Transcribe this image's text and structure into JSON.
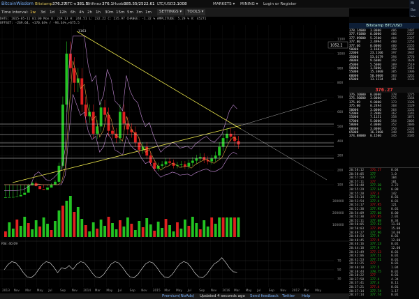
{
  "topbar": {
    "logo": "BitcoinWisdom",
    "markets": [
      {
        "name": "Bitstamp",
        "price": "376.27",
        "active": true
      },
      {
        "name": "BTC-e",
        "price": "381.5"
      },
      {
        "name": "Bitfinex",
        "price": "376.1"
      },
      {
        "name": "Huobi",
        "price": "385.55/2522.61"
      },
      {
        "name": "LTC/USD",
        "price": "3.1008"
      }
    ],
    "markets_menu": "MARKETS",
    "mining_menu": "MINING",
    "login": "Login or Register",
    "right_partial": [
      "Bi",
      "Re",
      "Ha"
    ]
  },
  "toolbar": {
    "label": "Time Interval:",
    "intervals": [
      "1w",
      "3d",
      "1d",
      "12h",
      "6h",
      "4h",
      "2h",
      "1h",
      "30m",
      "15m",
      "5m",
      "3m",
      "1m"
    ],
    "selected": "1w",
    "settings": "SETTINGS",
    "tools": "TOOLS"
  },
  "info": {
    "line1": "DATE: 2015-05-11 01:00 Mon   O: 239.13  H: 244.51   L: 232.22   C: 235.97  CHANGE: -1.32 %  AMPLITUDE: 5.29 %  V: 45271",
    "line2": "OFFSET: -269.64, +170.64% / -94.34%,+675.5"
  },
  "chart_data": {
    "type": "candlestick",
    "x_axis_labels": [
      "2013",
      "Nov",
      "Mar",
      "May",
      "Jul",
      "Sep",
      "Nov",
      "2014",
      "Mar",
      "May",
      "Jul",
      "Sep",
      "Nov",
      "2015",
      "Mar",
      "May",
      "Jul",
      "Sep",
      "Nov",
      "2016",
      "Mar",
      "May",
      "Jul",
      "Sep",
      "Nov",
      "2017",
      "Mar",
      "May",
      "Nov"
    ],
    "y_axis_labels": [
      "1100",
      "1000",
      "900",
      "800",
      "700",
      "600",
      "500",
      "400",
      "300",
      "200",
      "100"
    ],
    "price_box": "1052.2",
    "peak_label": "1163",
    "volume_axis_labels": [
      "300000",
      "200000",
      "100000"
    ],
    "rsi_label": "RSI: 40.09",
    "rsi_axis_labels": [
      "70",
      "50",
      "30"
    ],
    "close_series": [
      14,
      15,
      16,
      20,
      30,
      45,
      95,
      110,
      90,
      70,
      65,
      80,
      100,
      120,
      230,
      650,
      1000,
      900,
      800,
      830,
      650,
      570,
      600,
      450,
      500,
      630,
      580,
      470,
      450,
      420,
      600,
      520,
      480,
      460,
      390,
      340,
      360,
      300,
      250,
      210,
      230,
      240,
      260,
      250,
      230,
      235,
      240,
      225,
      250,
      265,
      280,
      290,
      270,
      260,
      280,
      300,
      360,
      420,
      450,
      430,
      400,
      376
    ]
  },
  "orderbook": {
    "title": "Bitstamp BTC/USD",
    "last_price": "376.27",
    "asks": [
      [
        "378.14000",
        "3.0000",
        "406",
        "2487"
      ],
      [
        "377.91000",
        "0.0000",
        "406",
        "2337"
      ],
      [
        "377.89000",
        "5.2500",
        "404",
        "2327"
      ],
      [
        "377.80",
        "2.4994",
        "400",
        "2253"
      ],
      [
        "377.66",
        "0.0000",
        "400",
        "2155"
      ],
      [
        "50000",
        "3.1682",
        "398",
        "1988"
      ],
      [
        "22000",
        "23.1106",
        "397",
        "1947"
      ],
      [
        "35000",
        "53.6179",
        "394",
        "1776"
      ],
      [
        "40000",
        "9.6000",
        "392",
        "1628"
      ],
      [
        "45000",
        "5.5000",
        "389",
        "1519"
      ],
      [
        "50000",
        "1.5000",
        "387",
        "1413"
      ],
      [
        "55000",
        "15.3000",
        "385",
        "1306"
      ],
      [
        "60000",
        "50.0000",
        "383",
        "1261"
      ],
      [
        "65000",
        "13.1234",
        "381",
        "1133"
      ]
    ],
    "bids": [
      [
        "376.10000",
        "0.0000",
        "378",
        "1275"
      ],
      [
        "375.50000",
        "3.0000",
        "375",
        "1164"
      ],
      [
        "375.09",
        "9.0000",
        "373",
        "1126"
      ],
      [
        "375.00",
        "0.2494",
        "368",
        "1129"
      ],
      [
        "50000",
        "3.0000",
        "364",
        "1131"
      ],
      [
        "52000",
        "2.2000",
        "362",
        "1141"
      ],
      [
        "55000",
        "7.1151",
        "358",
        "1871"
      ],
      [
        "57000",
        "5.0000",
        "354",
        "2005"
      ],
      [
        "58000",
        "4.0000",
        "352",
        "2086"
      ],
      [
        "60000",
        "3.0000",
        "350",
        "2234"
      ],
      [
        "65000",
        "16.2000",
        "348",
        "2483"
      ],
      [
        "374.88000",
        "0.1500",
        "345",
        "3185"
      ]
    ],
    "trades": [
      [
        "20:58:12",
        "376.27",
        "0.04"
      ],
      [
        "20:58:05",
        "377",
        "1.0"
      ],
      [
        "20:57:59",
        "377",
        "104"
      ],
      [
        "20:57:11",
        "377",
        "101"
      ],
      [
        "20:56:48",
        "377.38",
        "3.72"
      ],
      [
        "20:55:29",
        "377.64",
        "0.08"
      ],
      [
        "20:55:28",
        "377.4",
        "142"
      ],
      [
        "20:55:14",
        "377.4",
        "0.01"
      ],
      [
        "20:53:54",
        "377.4",
        "0.01"
      ],
      [
        "20:53:17",
        "377.95",
        "121"
      ],
      [
        "20:52:30",
        "377.95",
        "0.01"
      ],
      [
        "20:54:09",
        "377.08",
        "0.00"
      ],
      [
        "20:52:30",
        "377.95",
        "2.01"
      ],
      [
        "20:52:11",
        "377.08",
        "0.34"
      ],
      [
        "20:50:05",
        "377.93",
        "11.88"
      ],
      [
        "20:50:03",
        "377.89",
        "15.00"
      ],
      [
        "20:49:27",
        "377.96",
        "14.00"
      ],
      [
        "20:48:54",
        "377.9",
        "0.01"
      ],
      [
        "20:48:45",
        "377.9",
        "12.00"
      ],
      [
        "20:46:16",
        "377.13",
        "0.01"
      ],
      [
        "20:44:10",
        "377.9",
        "12.00"
      ],
      [
        "20:42:49",
        "377.13",
        "0.01"
      ],
      [
        "20:42:06",
        "377.51",
        "0.01"
      ],
      [
        "20:41:53",
        "377.51",
        "0.01"
      ],
      [
        "20:41:25",
        "377",
        "0.01"
      ],
      [
        "20:40:10",
        "377.5",
        "1.04"
      ],
      [
        "20:38:44",
        "378.75",
        "0.01"
      ],
      [
        "20:38:22",
        "377",
        "0.01"
      ],
      [
        "20:37:58",
        "377.4",
        "4.34"
      ],
      [
        "20:37:41",
        "377.4",
        "0.11"
      ],
      [
        "20:37:21",
        "377.4",
        "0.01"
      ],
      [
        "20:37:14",
        "377.74",
        "1.17"
      ],
      [
        "20:37:14",
        "377.74",
        "0.01"
      ]
    ]
  },
  "footer": {
    "premium": "Premium(NoAds)",
    "updated": "Updated 4 seconds ago",
    "feedback": "Send feedback",
    "twitter": "Twitter",
    "help": "Help"
  },
  "colors": {
    "up": "#22c322",
    "down": "#e02020",
    "trendline": "#e8e34a",
    "bollinger": "#c58bd8",
    "ma": "#d8a040"
  }
}
